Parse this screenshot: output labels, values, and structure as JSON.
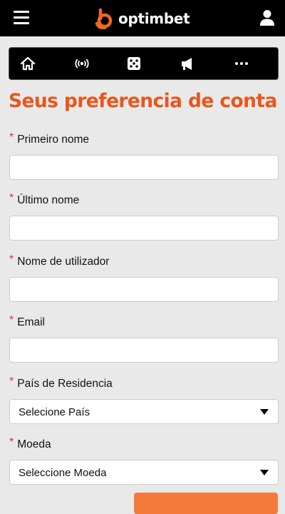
{
  "header": {
    "logo_text": "optimbet",
    "brand_color": "#f26722",
    "menu_icon": "hamburger-menu-icon",
    "user_icon": "user-icon"
  },
  "nav_icons": [
    {
      "name": "home-icon"
    },
    {
      "name": "live-broadcast-icon"
    },
    {
      "name": "dice-icon"
    },
    {
      "name": "megaphone-icon"
    },
    {
      "name": "more-dots-icon"
    }
  ],
  "form": {
    "title": "Seus preferencia de conta",
    "title_color": "#e8571d",
    "required_marker": "*",
    "fields": [
      {
        "label": "Primeiro nome",
        "value": "",
        "placeholder": ""
      },
      {
        "label": "Último nome",
        "value": "",
        "placeholder": ""
      },
      {
        "label": "Nome de utilizador",
        "value": "",
        "placeholder": ""
      },
      {
        "label": "Email",
        "value": "",
        "placeholder": ""
      }
    ],
    "selects": [
      {
        "label": "País de Residencia",
        "value": "Selecione País"
      },
      {
        "label": "Moeda",
        "value": "Seleccione Moeda"
      }
    ]
  }
}
